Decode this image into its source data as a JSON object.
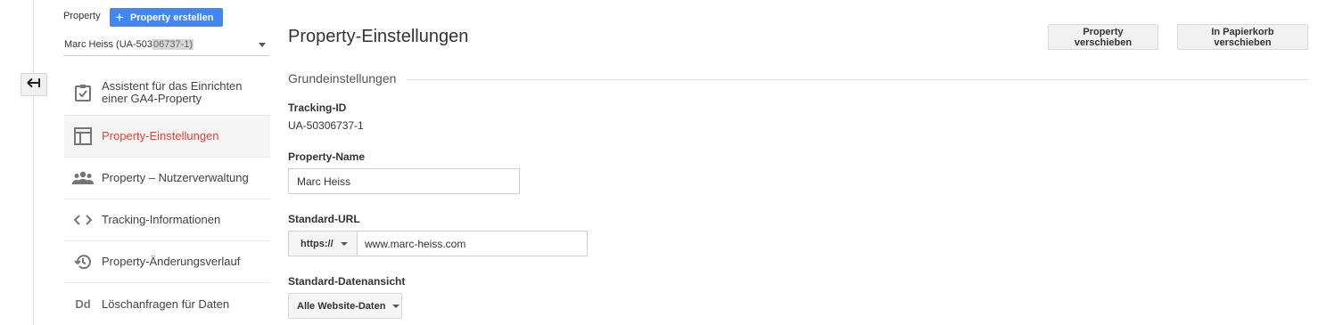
{
  "property_panel": {
    "label": "Property",
    "create_button": {
      "icon": "plus-icon",
      "label": "Property erstellen"
    },
    "selector": {
      "value_prefix": "Marc Heiss (UA-503",
      "value_redacted": "06737-1)"
    }
  },
  "nav": {
    "back_icon": "back-arrow-icon",
    "items": [
      {
        "icon": "checklist-icon",
        "line1": "Assistent für das Einrichten",
        "line2": "einer GA4-Property"
      },
      {
        "icon": "layout-icon",
        "label": "Property-Einstellungen",
        "active": true
      },
      {
        "icon": "people-icon",
        "label": "Property – Nutzerverwaltung"
      },
      {
        "icon": "code-icon",
        "label": "Tracking-Informationen"
      },
      {
        "icon": "history-icon",
        "label": "Property-Änderungsverlauf"
      },
      {
        "icon": "dd-icon",
        "icon_text": "Dd",
        "label": "Löschanfragen für Daten"
      }
    ]
  },
  "main": {
    "title": "Property-Einstellungen",
    "buttons": {
      "move": "Property verschieben",
      "trash": "In Papierkorb verschieben"
    },
    "section_title": "Grundeinstellungen",
    "tracking_id": {
      "label": "Tracking-ID",
      "value": "UA-50306737-1"
    },
    "property_name": {
      "label": "Property-Name",
      "value": "Marc Heiss"
    },
    "default_url": {
      "label": "Standard-URL",
      "protocol": "https://",
      "value": "www.marc-heiss.com"
    },
    "default_view": {
      "label": "Standard-Datenansicht",
      "value": "Alle Website-Daten"
    }
  },
  "colors": {
    "accent_blue": "#4285f4",
    "active_red": "#db4437",
    "icon_grey": "#757575"
  }
}
